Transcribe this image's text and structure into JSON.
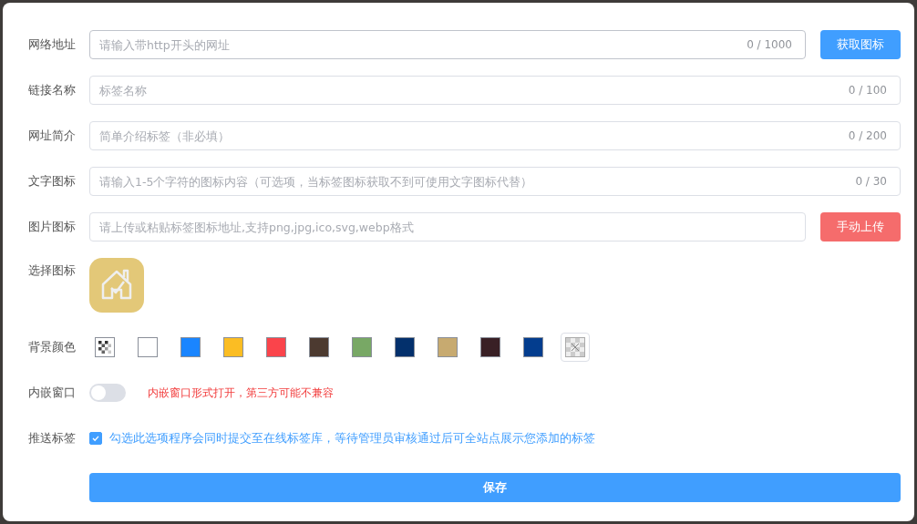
{
  "fields": [
    {
      "label": "网络地址",
      "placeholder": "请输入带http开头的网址",
      "counter": "0 / 1000",
      "button": {
        "label": "获取图标",
        "kind": "primary"
      }
    },
    {
      "label": "链接名称",
      "placeholder": "标签名称",
      "counter": "0 / 100"
    },
    {
      "label": "网址简介",
      "placeholder": "简单介绍标签（非必填）",
      "counter": "0 / 200"
    },
    {
      "label": "文字图标",
      "placeholder": "请输入1-5个字符的图标内容（可选项，当标签图标获取不到可使用文字图标代替）",
      "counter": "0 / 30"
    },
    {
      "label": "图片图标",
      "placeholder": "请上传或粘贴标签图标地址,支持png,jpg,ico,svg,webp格式",
      "button": {
        "label": "手动上传",
        "kind": "danger"
      }
    }
  ],
  "select_icon": {
    "label": "选择图标",
    "color": "#e3c878"
  },
  "background": {
    "label": "背景颜色",
    "swatches": [
      {
        "kind": "transparent"
      },
      {
        "kind": "solid",
        "color": "#ffffff"
      },
      {
        "kind": "solid",
        "color": "#1a85ff"
      },
      {
        "kind": "solid",
        "color": "#fbbd23"
      },
      {
        "kind": "solid",
        "color": "#fa444b"
      },
      {
        "kind": "solid",
        "color": "#4c3a30"
      },
      {
        "kind": "solid",
        "color": "#78a865"
      },
      {
        "kind": "solid",
        "color": "#03306c"
      },
      {
        "kind": "solid",
        "color": "#c7aa70"
      },
      {
        "kind": "solid",
        "color": "#392025"
      },
      {
        "kind": "solid",
        "color": "#033d8e"
      },
      {
        "kind": "none"
      }
    ]
  },
  "embed": {
    "label": "内嵌窗口",
    "on": false,
    "hint": "内嵌窗口形式打开，第三方可能不兼容"
  },
  "push": {
    "label": "推送标签",
    "checked": true,
    "text": "勾选此选项程序会同时提交至在线标签库，等待管理员审核通过后可全站点展示您添加的标签"
  },
  "save": "保存"
}
